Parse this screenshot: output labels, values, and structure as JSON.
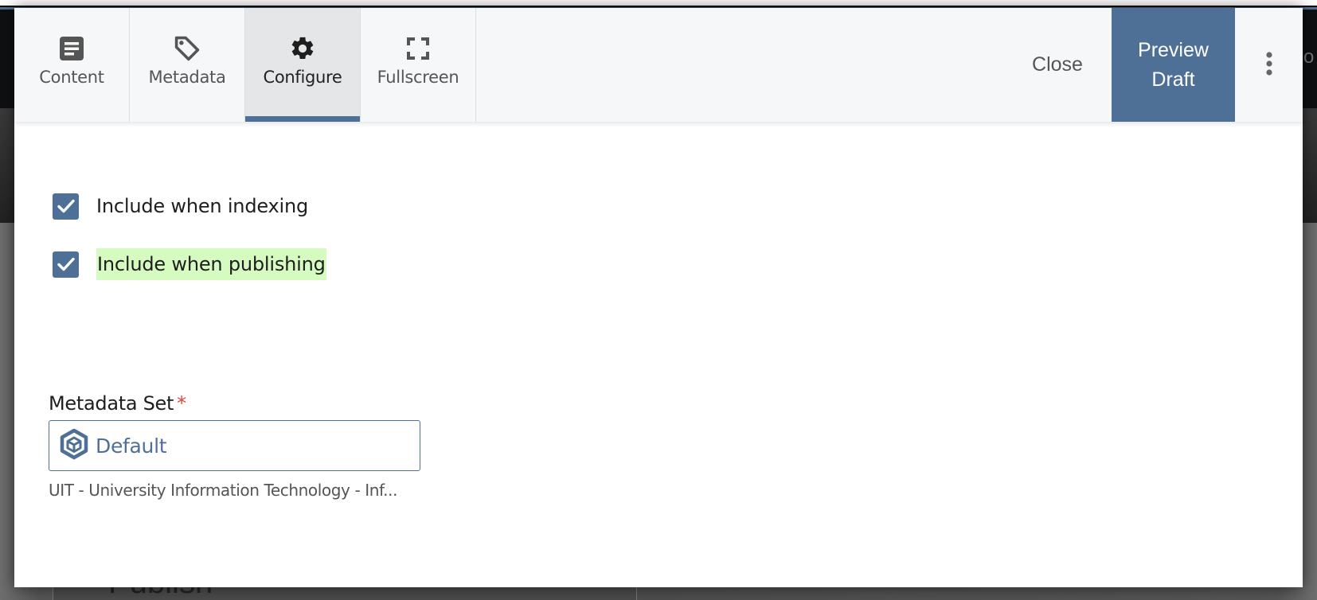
{
  "background": {
    "partial_header_text": "o",
    "partial_panel_text": "Publish"
  },
  "toolbar": {
    "tabs": [
      {
        "label": "Content",
        "icon": "document-icon",
        "active": false
      },
      {
        "label": "Metadata",
        "icon": "tag-icon",
        "active": false
      },
      {
        "label": "Configure",
        "icon": "gear-icon",
        "active": true
      },
      {
        "label": "Fullscreen",
        "icon": "fullscreen-icon",
        "active": false
      }
    ],
    "close_label": "Close",
    "preview_label_line1": "Preview",
    "preview_label_line2": "Draft",
    "more_icon": "kebab-vertical-icon"
  },
  "configure": {
    "include_indexing": {
      "label": "Include when indexing",
      "checked": true
    },
    "include_publishing": {
      "label": "Include when publishing",
      "checked": true,
      "highlighted": true
    },
    "metadata_set": {
      "label": "Metadata Set",
      "required_marker": "*",
      "value": "Default",
      "value_icon": "cube-icon",
      "path": "UIT - University Information Technology - Inf..."
    }
  },
  "colors": {
    "accent": "#4f7096",
    "active_tab_bg": "#e5e6e8",
    "toolbar_bg": "#f6f7f9",
    "highlight": "#d6fbc0",
    "required": "#e0463a"
  }
}
